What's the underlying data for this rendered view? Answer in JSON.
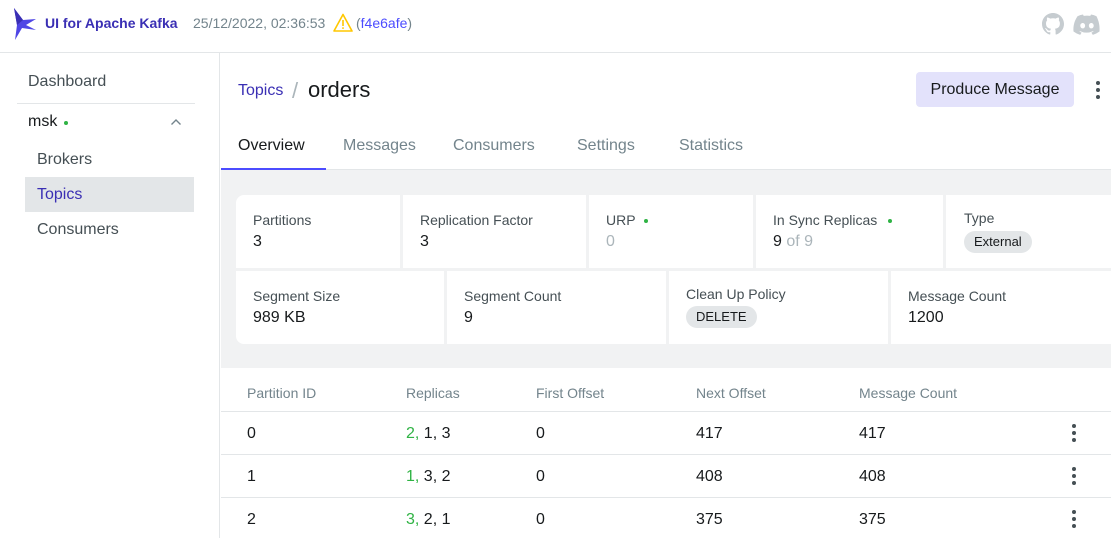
{
  "header": {
    "app_title": "UI for Apache Kafka",
    "build_date": "25/12/2022, 02:36:53",
    "commit_open": "(",
    "commit": "f4e6afe",
    "commit_close": ")"
  },
  "sidebar": {
    "dashboard": "Dashboard",
    "cluster": "msk",
    "items": [
      {
        "label": "Brokers"
      },
      {
        "label": "Topics"
      },
      {
        "label": "Consumers"
      }
    ]
  },
  "breadcrumb": {
    "parent": "Topics",
    "separator": "/",
    "current": "orders"
  },
  "actions": {
    "produce": "Produce Message"
  },
  "tabs": [
    "Overview",
    "Messages",
    "Consumers",
    "Settings",
    "Statistics"
  ],
  "stats": {
    "partitions": {
      "label": "Partitions",
      "value": "3"
    },
    "replication_factor": {
      "label": "Replication Factor",
      "value": "3"
    },
    "urp": {
      "label": "URP",
      "value": "0"
    },
    "in_sync": {
      "label": "In Sync Replicas",
      "value": "9",
      "total": "of 9"
    },
    "type": {
      "label": "Type",
      "value": "External"
    },
    "segment_size": {
      "label": "Segment Size",
      "value": "989 KB"
    },
    "segment_count": {
      "label": "Segment Count",
      "value": "9"
    },
    "cleanup_policy": {
      "label": "Clean Up Policy",
      "value": "DELETE"
    },
    "message_count": {
      "label": "Message Count",
      "value": "1200"
    }
  },
  "table": {
    "headers": [
      "Partition ID",
      "Replicas",
      "First Offset",
      "Next Offset",
      "Message Count"
    ],
    "rows": [
      {
        "partition": "0",
        "leader": "2,",
        "replicas": "1, 3",
        "first_offset": "0",
        "next_offset": "417",
        "message_count": "417"
      },
      {
        "partition": "1",
        "leader": "1,",
        "replicas": "3, 2",
        "first_offset": "0",
        "next_offset": "408",
        "message_count": "408"
      },
      {
        "partition": "2",
        "leader": "3,",
        "replicas": "2, 1",
        "first_offset": "0",
        "next_offset": "375",
        "message_count": "375"
      }
    ]
  },
  "colors": {
    "brand": "#3a2fb4",
    "accent": "#4c4cff",
    "success": "#2fb344",
    "warning": "#ffc700"
  },
  "icons": [
    "kafka-logo",
    "warning-icon",
    "github-icon",
    "discord-icon",
    "chevron-up-icon",
    "kebab-menu-icon"
  ]
}
